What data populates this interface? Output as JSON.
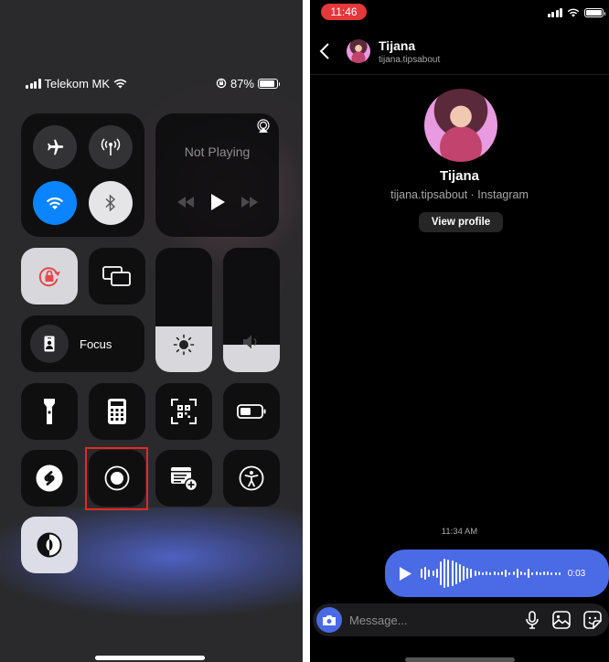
{
  "control_center": {
    "status_bar": {
      "carrier": "Telekom MK",
      "battery_percent_label": "87%",
      "battery_level": 0.87,
      "icons": [
        "signal-icon",
        "wifi-icon",
        "orientation-lock-icon",
        "battery-icon"
      ]
    },
    "connectivity": {
      "airplane_mode": {
        "icon": "airplane-icon",
        "active": false
      },
      "cellular_data": {
        "icon": "antenna-icon",
        "active": false
      },
      "wifi": {
        "icon": "wifi-icon",
        "active": true
      },
      "bluetooth": {
        "icon": "bluetooth-icon",
        "active": false
      }
    },
    "media": {
      "title": "Not Playing",
      "icons": [
        "airplay-icon",
        "rewind-icon",
        "play-icon",
        "fast-forward-icon"
      ]
    },
    "orientation_lock": {
      "icon": "orientation-lock-icon",
      "active": true,
      "color": "#e5484d"
    },
    "screen_mirroring": {
      "icon": "screen-mirroring-icon"
    },
    "focus": {
      "label": "Focus",
      "icon": "focus-badge-icon"
    },
    "brightness": {
      "icon": "sun-icon",
      "level": 0.37
    },
    "volume": {
      "icon": "speaker-icon",
      "level": 0.22
    },
    "tiles_row1": [
      "flashlight-icon",
      "calculator-icon",
      "qr-scanner-icon",
      "low-power-mode-icon"
    ],
    "tiles_row2": [
      "shazam-icon",
      "screen-recording-icon",
      "quick-note-icon",
      "accessibility-icon"
    ],
    "tiles_row3": [
      "dark-mode-icon"
    ],
    "highlight": {
      "target": "screen-recording",
      "color": "#e22b1f"
    }
  },
  "instagram_dm": {
    "status_bar": {
      "time": "11:46",
      "time_pill_color": "#e5383b"
    },
    "header": {
      "name": "Tijana",
      "username": "tijana.tipsabout"
    },
    "profile": {
      "name": "Tijana",
      "subtitle": "tijana.tipsabout · Instagram",
      "view_profile_label": "View profile"
    },
    "messages": [
      {
        "timestamp": "11:34 AM",
        "type": "voice",
        "duration": "0:03",
        "bubble_color": "#4a6ae6"
      }
    ],
    "composer": {
      "placeholder": "Message...",
      "icons": [
        "camera-icon",
        "microphone-icon",
        "gallery-icon",
        "sticker-icon"
      ]
    }
  }
}
